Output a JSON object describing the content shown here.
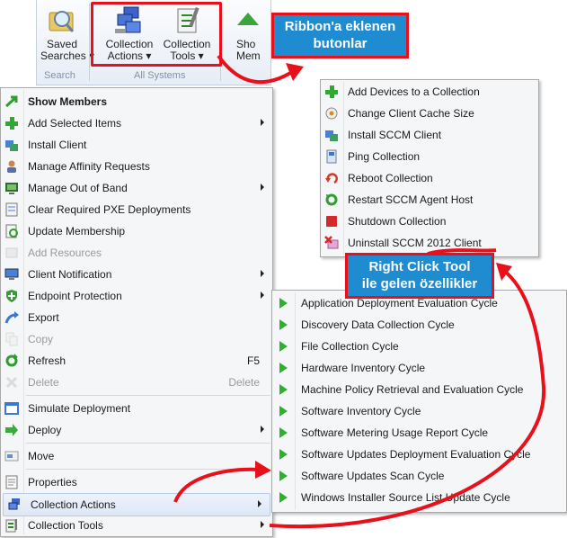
{
  "ribbon": {
    "saved_searches": "Saved\nSearches ▾",
    "search_group": "Search",
    "collection_actions": "Collection\nActions ▾",
    "collection_tools": "Collection\nTools ▾",
    "show_members_partial": "Sho\nMem",
    "all_systems_group": "All Systems"
  },
  "callouts": {
    "ribbon_note": "Ribbon'a eklenen\nbutonlar",
    "right_click_note": "Right Click Tool\nile gelen özellikler"
  },
  "context_menu": [
    {
      "label": "Show Members",
      "bold": true,
      "icon": "green-arrow-icon"
    },
    {
      "label": "Add Selected Items",
      "submenu": true,
      "icon": "green-plus-icon"
    },
    {
      "label": "Install Client",
      "icon": "install-client-icon"
    },
    {
      "label": "Manage Affinity Requests",
      "icon": "user-icon"
    },
    {
      "label": "Manage Out of Band",
      "submenu": true,
      "icon": "computer-board-icon"
    },
    {
      "label": "Clear Required PXE Deployments",
      "icon": "pxe-icon"
    },
    {
      "label": "Update Membership",
      "icon": "document-refresh-icon"
    },
    {
      "label": "Add Resources",
      "disabled": true,
      "icon": "add-resources-icon"
    },
    {
      "label": "Client Notification",
      "submenu": true,
      "icon": "monitor-icon"
    },
    {
      "label": "Endpoint Protection",
      "submenu": true,
      "icon": "shield-icon"
    },
    {
      "label": "Export",
      "icon": "export-arrow-icon"
    },
    {
      "label": "Copy",
      "disabled": true,
      "icon": "copy-icon"
    },
    {
      "label": "Refresh",
      "shortcut": "F5",
      "icon": "refresh-icon"
    },
    {
      "label": "Delete",
      "shortcut": "Delete",
      "disabled": true,
      "icon": "delete-x-icon"
    },
    {
      "label": "Simulate Deployment",
      "icon": "window-icon"
    },
    {
      "label": "Deploy",
      "submenu": true,
      "icon": "deploy-arrow-icon"
    },
    {
      "label": "Move",
      "icon": "move-icon"
    },
    {
      "label": "Properties",
      "icon": "properties-icon"
    },
    {
      "label": "Collection Actions",
      "submenu": true,
      "icon": "computers-icon"
    },
    {
      "label": "Collection Tools",
      "submenu": true,
      "icon": "tools-icon"
    }
  ],
  "tools_menu": [
    {
      "label": "Add Devices to a Collection",
      "icon": "green-plus-icon"
    },
    {
      "label": "Change Client Cache Size",
      "icon": "cache-icon"
    },
    {
      "label": "Install SCCM Client",
      "icon": "install-client-icon"
    },
    {
      "label": "Ping Collection",
      "icon": "ping-icon"
    },
    {
      "label": "Reboot Collection",
      "icon": "reboot-icon"
    },
    {
      "label": "Restart SCCM Agent Host",
      "icon": "restart-icon"
    },
    {
      "label": "Shutdown Collection",
      "icon": "stop-square-icon"
    },
    {
      "label": "Uninstall SCCM 2012 Client",
      "icon": "uninstall-icon"
    }
  ],
  "actions_menu": [
    "Application Deployment Evaluation Cycle",
    "Discovery Data Collection Cycle",
    "File Collection Cycle",
    "Hardware Inventory Cycle",
    "Machine Policy Retrieval and Evaluation Cycle",
    "Software Inventory Cycle",
    "Software Metering Usage Report Cycle",
    "Software Updates Deployment Evaluation Cycle",
    "Software Updates Scan Cycle",
    "Windows Installer Source List Update Cycle"
  ],
  "colors": {
    "accent_red": "#e8101a",
    "callout_blue": "#1f8bd1",
    "action_green": "#2fb02f"
  }
}
